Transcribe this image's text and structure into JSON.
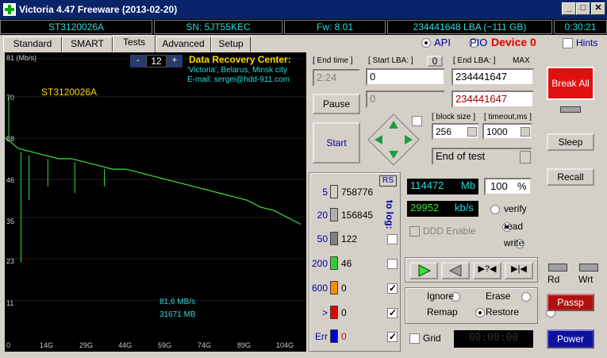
{
  "window": {
    "title": "Victoria 4.47  Freeware (2013-02-20)",
    "min": "_",
    "max": "□",
    "close": "✕"
  },
  "info": {
    "model": "ST3120026A",
    "serial": "SN: 5JT55KEC",
    "firmware": "Fw: 8.01",
    "lba": "234441648 LBA (~111 GB)",
    "time": "0:30:21"
  },
  "tabs": [
    "Standard",
    "SMART",
    "Tests",
    "Advanced",
    "Setup"
  ],
  "mode": {
    "api": "API",
    "pio": "PIO",
    "device": "Device 0",
    "hints": "Hints"
  },
  "graph": {
    "y_labels": [
      "81 (Mb/s)",
      "70",
      "58",
      "46",
      "35",
      "23",
      "11",
      "0"
    ],
    "x_labels": [
      "14G",
      "29G",
      "44G",
      "59G",
      "74G",
      "89G",
      "104G"
    ],
    "zoom": "12",
    "zoom_minus": "-",
    "zoom_plus": "+",
    "drive": "ST3120026A",
    "dr_title": "Data Recovery Center:",
    "dr_line1": "'Victoria', Belarus, Minsk city",
    "dr_line2": "E-mail: sergei@hdd-911.com",
    "speed": "81,6 MB/s",
    "position": "31671 MB"
  },
  "chart_data": {
    "type": "line",
    "title": "",
    "ylabel": "(Mb/s)",
    "xlabel": "",
    "ylim": [
      0,
      81
    ],
    "x_unit": "GB",
    "x": [
      0,
      2,
      5,
      10,
      15,
      20,
      25,
      30,
      35,
      40,
      45,
      50,
      55,
      60,
      65,
      70,
      75,
      80,
      85,
      90,
      95,
      100,
      105,
      110
    ],
    "values": [
      58,
      57,
      55,
      54,
      53,
      52,
      52,
      51,
      50,
      49,
      49,
      48,
      47,
      46,
      45,
      44,
      43,
      42,
      41,
      40,
      38,
      37,
      35,
      33
    ],
    "color": "#3ee03e"
  },
  "lba": {
    "end_time_label": "[ End time ]",
    "end_time": "2:24",
    "start_label": "[ Start LBA: ]",
    "start_zero": "0",
    "start": "0",
    "end_label": "[ End LBA: ]",
    "max": "MAX",
    "end": "234441647",
    "current": "0",
    "current_end": "234441647"
  },
  "controls": {
    "pause": "Pause",
    "start": "Start",
    "block_label": "[ block size ]",
    "block": "256",
    "timeout_label": "[ timeout,ms ]",
    "timeout": "1000",
    "action": "End of test",
    "break": "Break All",
    "sleep": "Sleep",
    "recall": "Recall",
    "rd": "Rd",
    "wrt": "Wrt",
    "passp": "Passp",
    "power": "Power"
  },
  "blocks": {
    "rs": "RS",
    "to_log": "to log:",
    "rows": [
      {
        "label": "5",
        "count": "758776",
        "color": "#d4d0c8"
      },
      {
        "label": "20",
        "count": "156845",
        "color": "#b0b0b0"
      },
      {
        "label": "50",
        "count": "122",
        "color": "#808080"
      },
      {
        "label": "200",
        "count": "46",
        "color": "#33cc33"
      },
      {
        "label": "600",
        "count": "0",
        "color": "#ff8c00"
      },
      {
        "label": ">",
        "count": "0",
        "color": "#e00000"
      },
      {
        "label": "Err",
        "count": "0",
        "color": "#0000cc"
      }
    ]
  },
  "stats": {
    "mb": "114472",
    "mb_unit": "Mb",
    "pct": "100",
    "pct_unit": "%",
    "kbs": "29952",
    "kbs_unit": "kb/s",
    "ddd": "DDD Enable",
    "verify": "verify",
    "read": "read",
    "write": "write",
    "ignore": "Ignore",
    "erase": "Erase",
    "remap": "Remap",
    "restore": "Restore",
    "grid": "Grid",
    "timer": "00:00:00"
  }
}
